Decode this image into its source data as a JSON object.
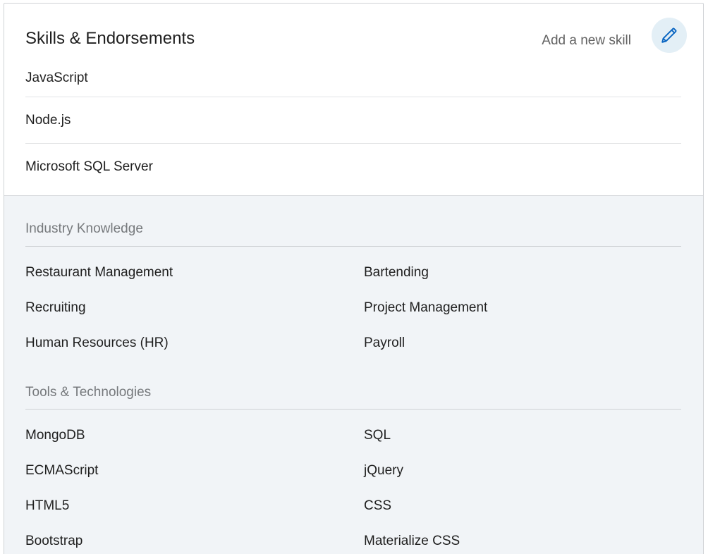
{
  "header": {
    "title": "Skills & Endorsements",
    "add_skill_label": "Add a new skill",
    "edit_icon": "pencil-icon"
  },
  "top_skills": [
    "JavaScript",
    "Node.js",
    "Microsoft SQL Server"
  ],
  "categories": [
    {
      "title": "Industry Knowledge",
      "skills": [
        "Restaurant Management",
        "Bartending",
        "Recruiting",
        "Project Management",
        "Human Resources (HR)",
        "Payroll"
      ]
    },
    {
      "title": "Tools & Technologies",
      "skills": [
        "MongoDB",
        "SQL",
        "ECMAScript",
        "jQuery",
        "HTML5",
        "CSS",
        "Bootstrap",
        "Materialize CSS"
      ]
    }
  ],
  "colors": {
    "accent": "#0a66c2",
    "edit_button_bg": "#e3eff6",
    "category_bg": "#f1f4f7"
  }
}
